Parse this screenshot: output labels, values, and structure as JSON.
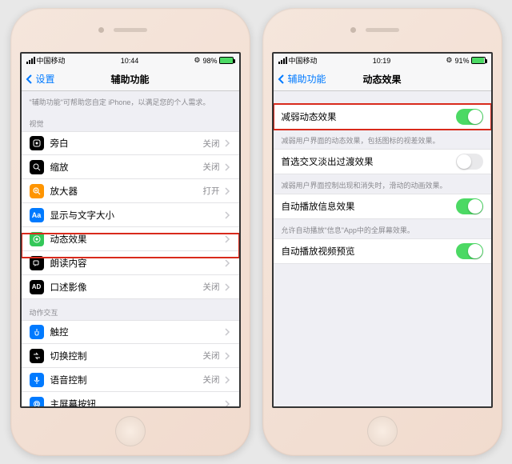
{
  "left": {
    "status": {
      "carrier": "中国移动",
      "time": "10:44",
      "battery": "98%"
    },
    "nav": {
      "back": "设置",
      "title": "辅助功能"
    },
    "intro": "\"辅助功能\"可帮助您自定 iPhone，以满足您的个人需求。",
    "section_vision": "视觉",
    "rows_vision": [
      {
        "label": "旁白",
        "value": "关闭",
        "icon": "voiceover",
        "bg": "#000"
      },
      {
        "label": "缩放",
        "value": "关闭",
        "icon": "zoom",
        "bg": "#000"
      },
      {
        "label": "放大器",
        "value": "打开",
        "icon": "magnifier",
        "bg": "#ff9500"
      },
      {
        "label": "显示与文字大小",
        "value": "",
        "icon": "textsize",
        "bg": "#007aff"
      },
      {
        "label": "动态效果",
        "value": "",
        "icon": "motion",
        "bg": "#34c759"
      },
      {
        "label": "朗读内容",
        "value": "",
        "icon": "speech",
        "bg": "#000"
      },
      {
        "label": "口述影像",
        "value": "关闭",
        "icon": "audio-desc",
        "bg": "#000"
      }
    ],
    "section_motor": "动作交互",
    "rows_motor": [
      {
        "label": "触控",
        "value": "",
        "icon": "touch",
        "bg": "#007aff"
      },
      {
        "label": "切换控制",
        "value": "关闭",
        "icon": "switch",
        "bg": "#000"
      },
      {
        "label": "语音控制",
        "value": "关闭",
        "icon": "voice",
        "bg": "#007aff"
      },
      {
        "label": "主屏幕按钮",
        "value": "",
        "icon": "home",
        "bg": "#007aff"
      }
    ]
  },
  "right": {
    "status": {
      "carrier": "中国移动",
      "time": "10:19",
      "battery": "91%"
    },
    "nav": {
      "back": "辅助功能",
      "title": "动态效果"
    },
    "rows": [
      {
        "label": "减弱动态效果",
        "toggle": true,
        "note": "减弱用户界面的动态效果，包括图标的视差效果。"
      },
      {
        "label": "首选交叉淡出过渡效果",
        "toggle": false,
        "note": "减弱用户界面控制出现和消失时，滑动的动画效果。"
      },
      {
        "label": "自动播放信息效果",
        "toggle": true,
        "note": "允许自动播放\"信息\"App中的全屏幕效果。"
      },
      {
        "label": "自动播放视频预览",
        "toggle": true,
        "note": ""
      }
    ]
  }
}
